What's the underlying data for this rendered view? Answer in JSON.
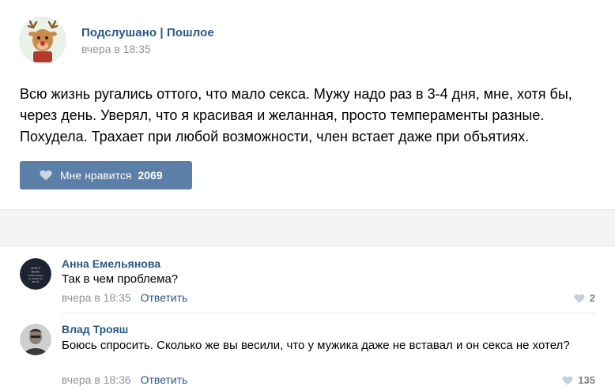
{
  "post": {
    "author": "Подслушано | Пошлое",
    "date": "вчера в 18:35",
    "text": "Всю жизнь ругались оттого, что мало секса. Мужу надо раз в 3-4 дня, мне, хотя бы, через день. Уверял, что я красивая и желанная, просто темпераменты разные. Похудела. Трахает при любой возможности, член встает даже при объятиях.",
    "like_label": "Мне нравится",
    "like_count": "2069"
  },
  "comments": [
    {
      "author": "Анна Емельянова",
      "text": "Так в чем проблема?",
      "date": "вчера в 18:35",
      "reply_label": "Ответить",
      "likes": "2",
      "avatar_caption": "DON'T PANIC EVERYTHING IS GOING TO BE OK"
    },
    {
      "author": "Влад Трояш",
      "text": "Боюсь спросить. Сколько же вы весили, что у мужика даже не вставал и он секса не хотел?",
      "date": "вчера в 18:36",
      "reply_label": "Ответить",
      "likes": "135"
    }
  ],
  "colors": {
    "link": "#2a5885",
    "like_button": "#5b7fa6",
    "muted": "#939393",
    "separator": "#f2f4f6"
  },
  "icons": {
    "like_button_icon": "heart-icon",
    "comment_like_icon": "heart-icon"
  }
}
